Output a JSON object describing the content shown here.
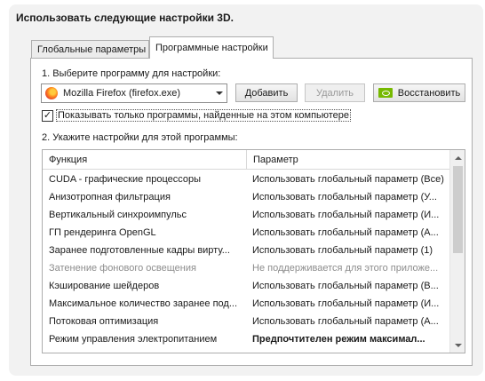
{
  "heading": "Использовать следующие настройки 3D.",
  "tabs": [
    {
      "label": "Глобальные параметры",
      "active": false
    },
    {
      "label": "Программные настройки",
      "active": true
    }
  ],
  "step1_label": "1. Выберите программу для настройки:",
  "program_select": {
    "value": "Mozilla Firefox (firefox.exe)",
    "icon": "firefox-icon"
  },
  "buttons": {
    "add": "Добавить",
    "remove": "Удалить",
    "restore": "Восстановить"
  },
  "checkbox": {
    "checked": true,
    "label": "Показывать только программы, найденные на этом компьютере"
  },
  "step2_label": "2. Укажите настройки для этой программы:",
  "table": {
    "columns": [
      "Функция",
      "Параметр"
    ],
    "rows": [
      {
        "feature": "CUDA - графические процессоры",
        "value": "Использовать глобальный параметр (Все)",
        "state": "normal"
      },
      {
        "feature": "Анизотропная фильтрация",
        "value": "Использовать глобальный параметр (У...",
        "state": "normal"
      },
      {
        "feature": "Вертикальный синхроимпульс",
        "value": "Использовать глобальный параметр (И...",
        "state": "normal"
      },
      {
        "feature": "ГП рендеринга OpenGL",
        "value": "Использовать глобальный параметр (А...",
        "state": "normal"
      },
      {
        "feature": "Заранее подготовленные кадры вирту...",
        "value": "Использовать глобальный параметр (1)",
        "state": "normal"
      },
      {
        "feature": "Затенение фонового освещения",
        "value": "Не поддерживается для этого приложе...",
        "state": "disabled"
      },
      {
        "feature": "Кэширование шейдеров",
        "value": "Использовать глобальный параметр (В...",
        "state": "normal"
      },
      {
        "feature": "Максимальное количество заранее под...",
        "value": "Использовать глобальный параметр (И...",
        "state": "normal"
      },
      {
        "feature": "Потоковая оптимизация",
        "value": "Использовать глобальный параметр (А...",
        "state": "normal"
      },
      {
        "feature": "Режим управления электропитанием",
        "value": "Предпочтителен режим максимал...",
        "state": "bold"
      }
    ]
  },
  "colors": {
    "panel_bg": "#f2f2f2",
    "nvidia_green": "#76b900",
    "disabled_text": "#8c8c8c"
  }
}
